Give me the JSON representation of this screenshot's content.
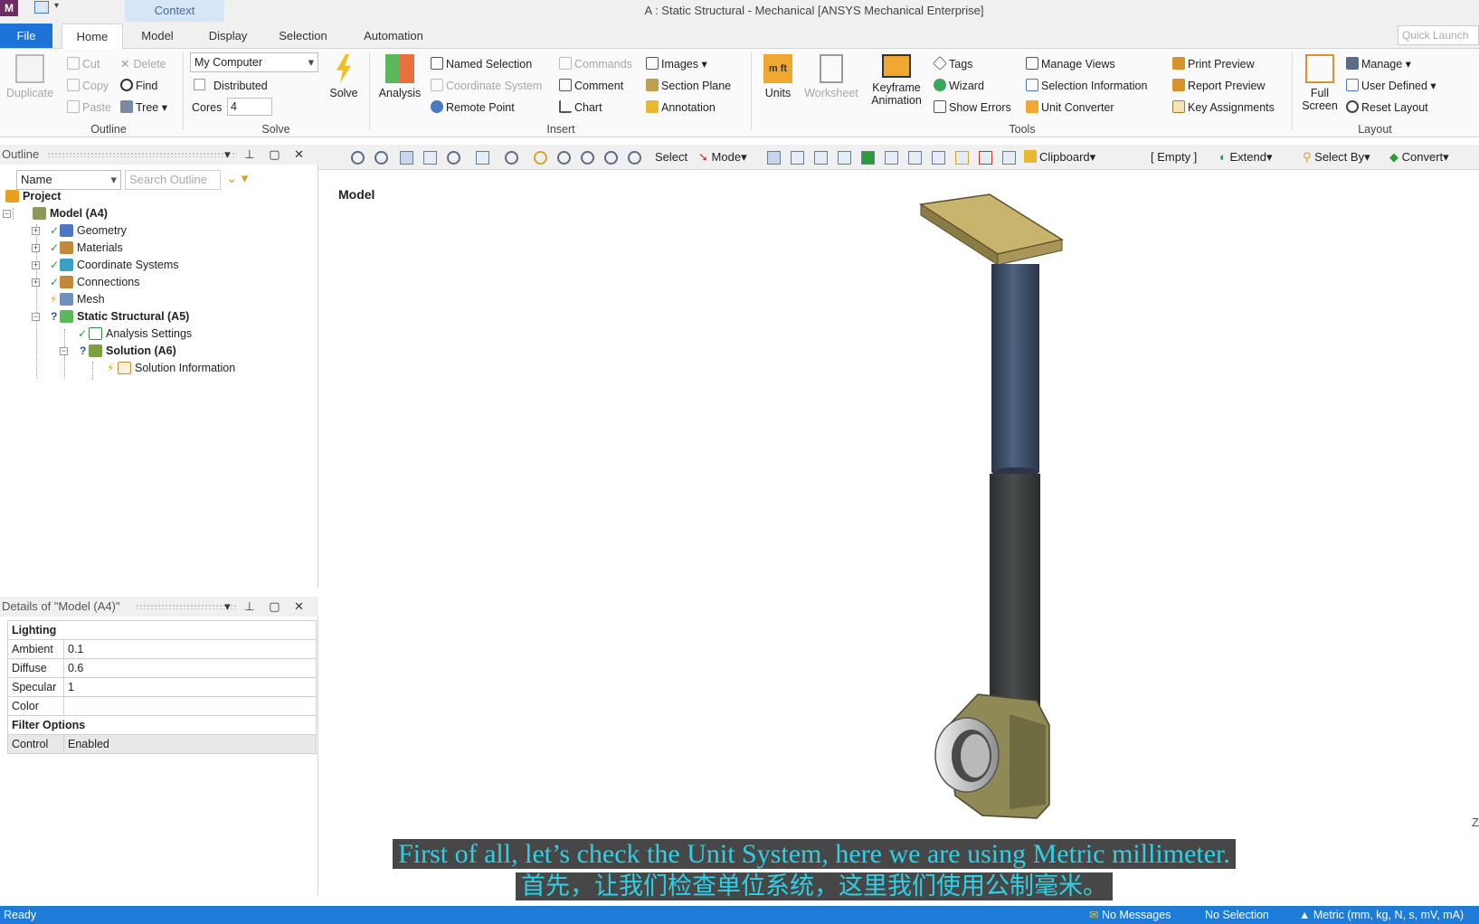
{
  "titlebar": {
    "app_icon": "M",
    "context_tab": "Context",
    "window_title": "A : Static Structural - Mechanical [ANSYS Mechanical Enterprise]"
  },
  "tabs": {
    "file": "File",
    "items": [
      "Home",
      "Model",
      "Display",
      "Selection",
      "Automation"
    ],
    "quick_launch_placeholder": "Quick Launch"
  },
  "ribbon": {
    "outline_group": {
      "duplicate": "Duplicate",
      "cut": "Cut",
      "copy": "Copy",
      "paste": "Paste",
      "delete": "Delete",
      "find": "Find",
      "tree": "Tree",
      "label": "Outline"
    },
    "solve_group": {
      "computer": "My Computer",
      "distributed": "Distributed",
      "cores_label": "Cores",
      "cores_value": "4",
      "solve": "Solve",
      "label": "Solve"
    },
    "insert_group": {
      "analysis": "Analysis",
      "named_selection": "Named Selection",
      "coordinate_system": "Coordinate System",
      "remote_point": "Remote Point",
      "commands": "Commands",
      "comment": "Comment",
      "chart": "Chart",
      "images": "Images",
      "section_plane": "Section Plane",
      "annotation": "Annotation",
      "label": "Insert"
    },
    "tools_group": {
      "units": "Units",
      "worksheet": "Worksheet",
      "keyframe": "Keyframe",
      "animation": "Animation",
      "tags": "Tags",
      "wizard": "Wizard",
      "show_errors": "Show Errors",
      "manage_views": "Manage Views",
      "selection_information": "Selection Information",
      "unit_converter": "Unit Converter",
      "print_preview": "Print Preview",
      "report_preview": "Report Preview",
      "key_assignments": "Key Assignments",
      "label": "Tools"
    },
    "layout_group": {
      "full": "Full",
      "screen": "Screen",
      "manage": "Manage",
      "user_defined": "User Defined",
      "reset_layout": "Reset Layout",
      "label": "Layout"
    }
  },
  "outline": {
    "title": "Outline",
    "filter": "Name",
    "search_placeholder": "Search Outline",
    "tree": {
      "project": "Project",
      "model": "Model (A4)",
      "geometry": "Geometry",
      "materials": "Materials",
      "coordinate_systems": "Coordinate Systems",
      "connections": "Connections",
      "mesh": "Mesh",
      "static_structural": "Static Structural (A5)",
      "analysis_settings": "Analysis Settings",
      "solution": "Solution (A6)",
      "solution_information": "Solution Information"
    }
  },
  "details": {
    "title": "Details of \"Model (A4)\"",
    "lighting": "Lighting",
    "rows": [
      {
        "key": "Ambient",
        "value": "0.1"
      },
      {
        "key": "Diffuse",
        "value": "0.6"
      },
      {
        "key": "Specular",
        "value": "1"
      },
      {
        "key": "Color",
        "value": ""
      }
    ],
    "filter_options": "Filter Options",
    "control_key": "Control",
    "control_value": "Enabled"
  },
  "graphics_toolbar": {
    "select": "Select",
    "mode": "Mode",
    "clipboard": "Clipboard",
    "empty": "[ Empty ]",
    "extend": "Extend",
    "select_by": "Select By",
    "convert": "Convert"
  },
  "viewport": {
    "title": "Model",
    "triad_label": "Z"
  },
  "subtitles": {
    "english": "First of all, let’s check the Unit System, here we are using Metric millimeter.",
    "chinese": "首先，让我们检查单位系统，这里我们使用公制毫米。"
  },
  "status": {
    "ready": "Ready",
    "messages": "No Messages",
    "selection": "No Selection",
    "units": "Metric (mm, kg, N, s, mV, mA)"
  },
  "colors": {
    "accent": "#1f7bd8",
    "subtitle_text": "#2fd0e6",
    "plate": "#c9b46e",
    "upper_tube": "#3e5068",
    "lower_tube": "#3c3f40",
    "fitting": "#8f8a55"
  }
}
